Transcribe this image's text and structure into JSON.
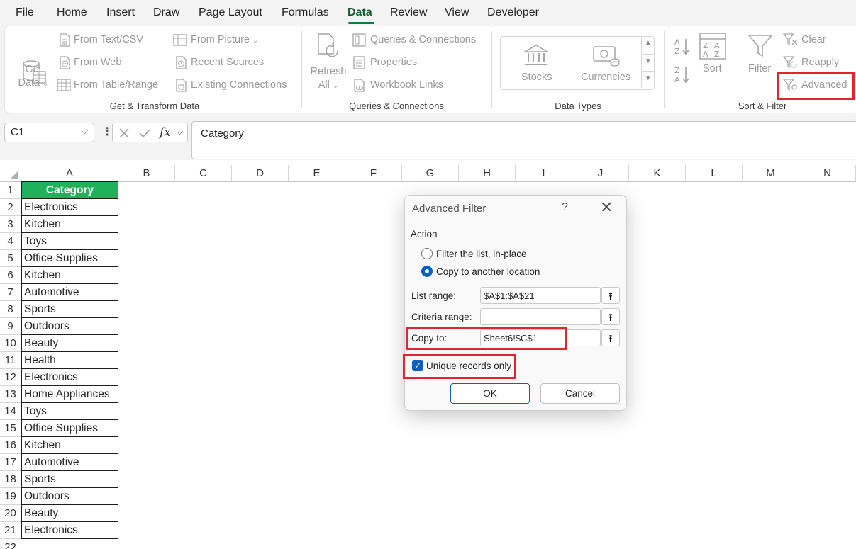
{
  "menu": {
    "items": [
      "File",
      "Home",
      "Insert",
      "Draw",
      "Page Layout",
      "Formulas",
      "Data",
      "Review",
      "View",
      "Developer"
    ],
    "active": "Data"
  },
  "ribbon": {
    "get_transform": {
      "get_data": "Get",
      "get_data_2": "Data",
      "from_text_csv": "From Text/CSV",
      "from_web": "From Web",
      "from_table_range": "From Table/Range",
      "from_picture": "From Picture",
      "recent_sources": "Recent Sources",
      "existing_connections": "Existing Connections",
      "label": "Get & Transform Data"
    },
    "queries": {
      "refresh": "Refresh",
      "refresh_2": "All",
      "queries_connections": "Queries & Connections",
      "properties": "Properties",
      "workbook_links": "Workbook Links",
      "label": "Queries & Connections"
    },
    "data_types": {
      "stocks": "Stocks",
      "currencies": "Currencies",
      "label": "Data Types"
    },
    "sort_filter": {
      "sort": "Sort",
      "filter": "Filter",
      "clear": "Clear",
      "reapply": "Reapply",
      "advanced": "Advanced",
      "label": "Sort & Filter"
    }
  },
  "formula_bar": {
    "name_box": "C1",
    "formula": "Category"
  },
  "grid": {
    "columns": [
      "A",
      "B",
      "C",
      "D",
      "E",
      "F",
      "G",
      "H",
      "I",
      "J",
      "K",
      "L",
      "M",
      "N"
    ],
    "rows": [
      "1",
      "2",
      "3",
      "4",
      "5",
      "6",
      "7",
      "8",
      "9",
      "10",
      "11",
      "12",
      "13",
      "14",
      "15",
      "16",
      "17",
      "18",
      "19",
      "20",
      "21",
      "22"
    ],
    "column_a": [
      "Category",
      "Electronics",
      "Kitchen",
      "Toys",
      "Office Supplies",
      "Kitchen",
      "Automotive",
      "Sports",
      "Outdoors",
      "Beauty",
      "Health",
      "Electronics",
      "Home Appliances",
      "Toys",
      "Office Supplies",
      "Kitchen",
      "Automotive",
      "Sports",
      "Outdoors",
      "Beauty",
      "Electronics"
    ]
  },
  "dialog": {
    "title": "Advanced Filter",
    "help": "?",
    "close": "✕",
    "action_label": "Action",
    "option_filter_in_place": "Filter the list, in-place",
    "option_copy_location": "Copy to another location",
    "list_range_label": "List range:",
    "list_range_value": "$A$1:$A$21",
    "criteria_range_label": "Criteria range:",
    "criteria_range_value": "",
    "copy_to_label": "Copy to:",
    "copy_to_value": "Sheet6!$C$1",
    "unique_label": "Unique records only",
    "ok": "OK",
    "cancel": "Cancel"
  },
  "colors": {
    "header_fill": "#1fb25a",
    "highlight": "#e0252f",
    "accent": "#0f5fc2",
    "data_tab": "#0f7b3f"
  }
}
